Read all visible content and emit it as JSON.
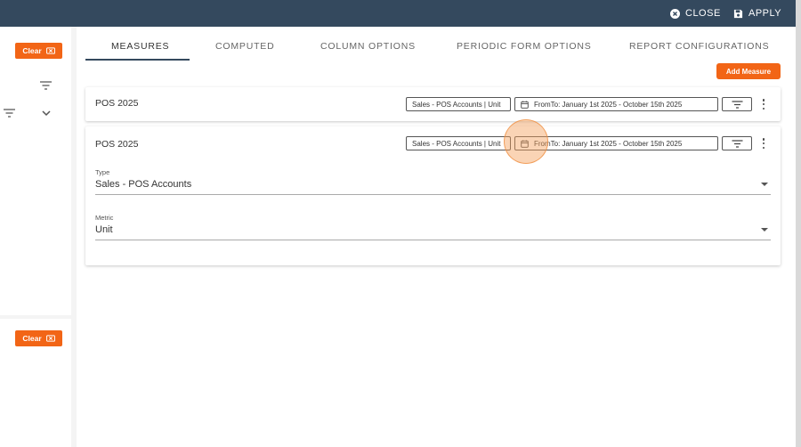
{
  "topbar": {
    "close_label": "CLOSE",
    "apply_label": "APPLY"
  },
  "left_panel": {
    "clear_label_top": "Clear",
    "clear_label_bottom": "Clear"
  },
  "tabs": [
    {
      "label": "MEASURES",
      "active": true
    },
    {
      "label": "COMPUTED",
      "active": false
    },
    {
      "label": "COLUMN OPTIONS",
      "active": false
    },
    {
      "label": "PERIODIC FORM OPTIONS",
      "active": false
    },
    {
      "label": "REPORT CONFIGURATIONS",
      "active": false
    }
  ],
  "add_measure_label": "Add Measure",
  "measures": [
    {
      "title": "POS 2025",
      "type_chip": "Sales - POS Accounts | Unit",
      "date_chip": "FromTo: January 1st 2025 - October 15th 2025",
      "expanded": false
    },
    {
      "title": "POS 2025",
      "type_chip": "Sales - POS Accounts | Unit",
      "date_chip": "FromTo: January 1st 2025 - October 15th 2025",
      "expanded": true,
      "type_label": "Type",
      "type_value": "Sales - POS Accounts",
      "metric_label": "Metric",
      "metric_value": "Unit"
    }
  ],
  "colors": {
    "topbar": "#34495e",
    "accent": "#f26516"
  }
}
